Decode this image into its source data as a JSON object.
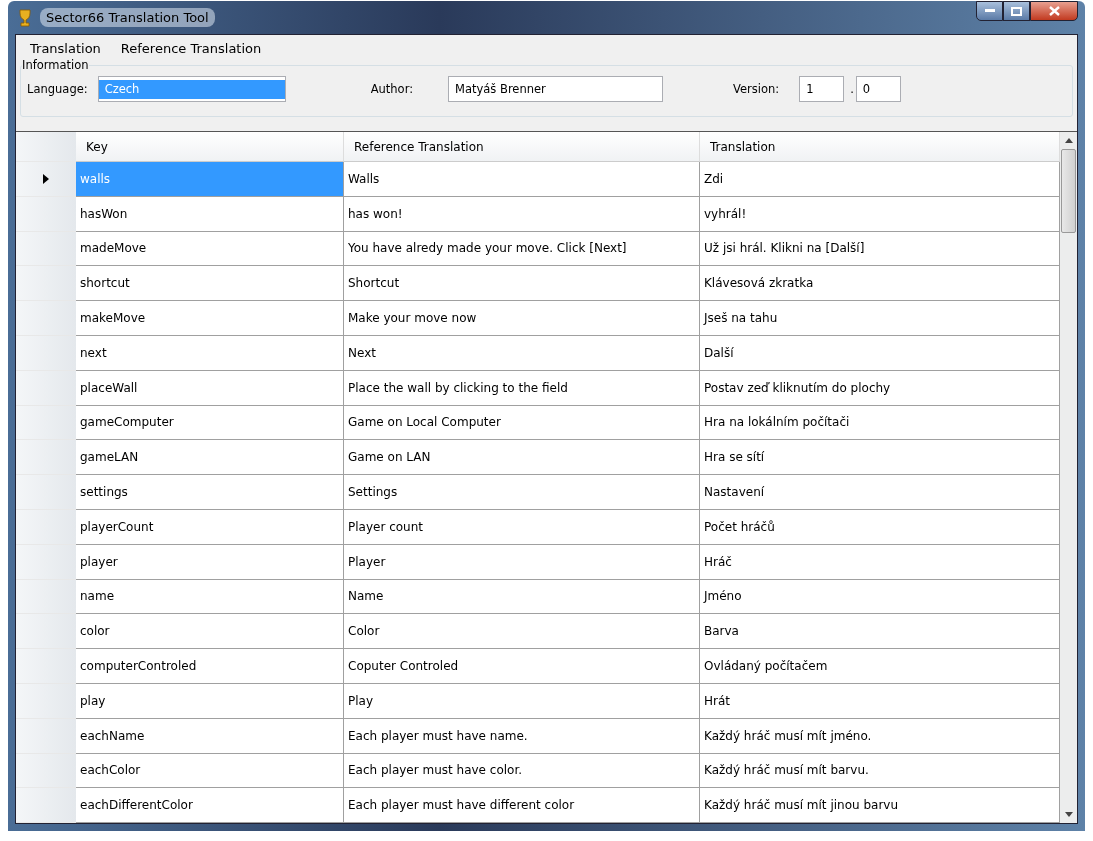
{
  "window": {
    "title": "Sector66 Translation Tool"
  },
  "menu": [
    {
      "label": "Translation"
    },
    {
      "label": "Reference Translation"
    }
  ],
  "information": {
    "title": "Information",
    "language": {
      "label": "Language:",
      "value": "Czech"
    },
    "author": {
      "label": "Author:",
      "value": "Matyáš Brenner"
    },
    "version": {
      "label": "Version:",
      "major": "1",
      "separator": ".",
      "minor": "0"
    }
  },
  "table": {
    "columns": [
      "Key",
      "Reference Translation",
      "Translation"
    ],
    "rows": [
      {
        "key": "walls",
        "reference": "Walls",
        "translation": "Zdi",
        "selected": true
      },
      {
        "key": "hasWon",
        "reference": "has won!",
        "translation": "vyhrál!",
        "selected": false
      },
      {
        "key": "madeMove",
        "reference": "You have alredy made your move. Click [Next]",
        "translation": "Už jsi hrál. Klikni na [Další]",
        "selected": false
      },
      {
        "key": "shortcut",
        "reference": "Shortcut",
        "translation": "Klávesová zkratka",
        "selected": false
      },
      {
        "key": "makeMove",
        "reference": "Make your move now",
        "translation": "Jseš na tahu",
        "selected": false
      },
      {
        "key": "next",
        "reference": "Next",
        "translation": "Další",
        "selected": false
      },
      {
        "key": "placeWall",
        "reference": "Place the wall by clicking to the field",
        "translation": "Postav zeď kliknutím do plochy",
        "selected": false
      },
      {
        "key": "gameComputer",
        "reference": "Game on Local Computer",
        "translation": "Hra na lokálním počítači",
        "selected": false
      },
      {
        "key": "gameLAN",
        "reference": "Game on LAN",
        "translation": "Hra se sítí",
        "selected": false
      },
      {
        "key": "settings",
        "reference": "Settings",
        "translation": "Nastavení",
        "selected": false
      },
      {
        "key": "playerCount",
        "reference": "Player count",
        "translation": "Počet hráčů",
        "selected": false
      },
      {
        "key": "player",
        "reference": "Player",
        "translation": "Hráč",
        "selected": false
      },
      {
        "key": "name",
        "reference": "Name",
        "translation": "Jméno",
        "selected": false
      },
      {
        "key": "color",
        "reference": "Color",
        "translation": "Barva",
        "selected": false
      },
      {
        "key": "computerControled",
        "reference": "Coputer Controled",
        "translation": "Ovládaný počítačem",
        "selected": false
      },
      {
        "key": "play",
        "reference": "Play",
        "translation": "Hrát",
        "selected": false
      },
      {
        "key": "eachName",
        "reference": "Each player must have name.",
        "translation": "Každý hráč musí mít jméno.",
        "selected": false
      },
      {
        "key": "eachColor",
        "reference": "Each player must have color.",
        "translation": "Každý hráč musí mít barvu.",
        "selected": false
      },
      {
        "key": "eachDifferentColor",
        "reference": "Each player must have different color",
        "translation": "Každý hráč musí mít jinou barvu",
        "selected": false
      }
    ]
  }
}
